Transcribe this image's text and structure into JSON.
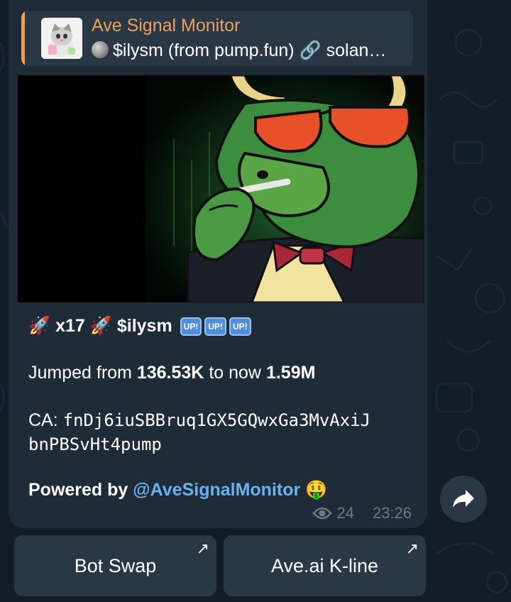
{
  "reply": {
    "title": "Ave Signal Monitor",
    "text": "$ilysm (from pump.fun) 🔗 solan…"
  },
  "message": {
    "rocket": "🚀",
    "multiplier": "x17",
    "ticker": "$ilysm",
    "up_badge": "UP!",
    "jump_prefix": "Jumped from ",
    "from_value": "136.53K",
    "jump_middle": " to now ",
    "to_value": "1.59M",
    "ca_label": "CA: ",
    "ca_line1": "fnDj6iuSBBruq1GX5GQwxGa3MvAxiJ",
    "ca_line2": "bnPBSvHt4pump",
    "powered_prefix": "Powered by ",
    "powered_link": "@AveSignalMonitor",
    "powered_emoji": "🤑",
    "views": "24",
    "time": "23:26"
  },
  "buttons": {
    "bot_swap": "Bot Swap",
    "kline": "Ave.ai K-line",
    "arrow": "↗"
  },
  "icons": {
    "reply_avatar": "cat-avatar-icon",
    "coin": "coin-icon",
    "views": "eye-icon",
    "share": "share-icon"
  }
}
